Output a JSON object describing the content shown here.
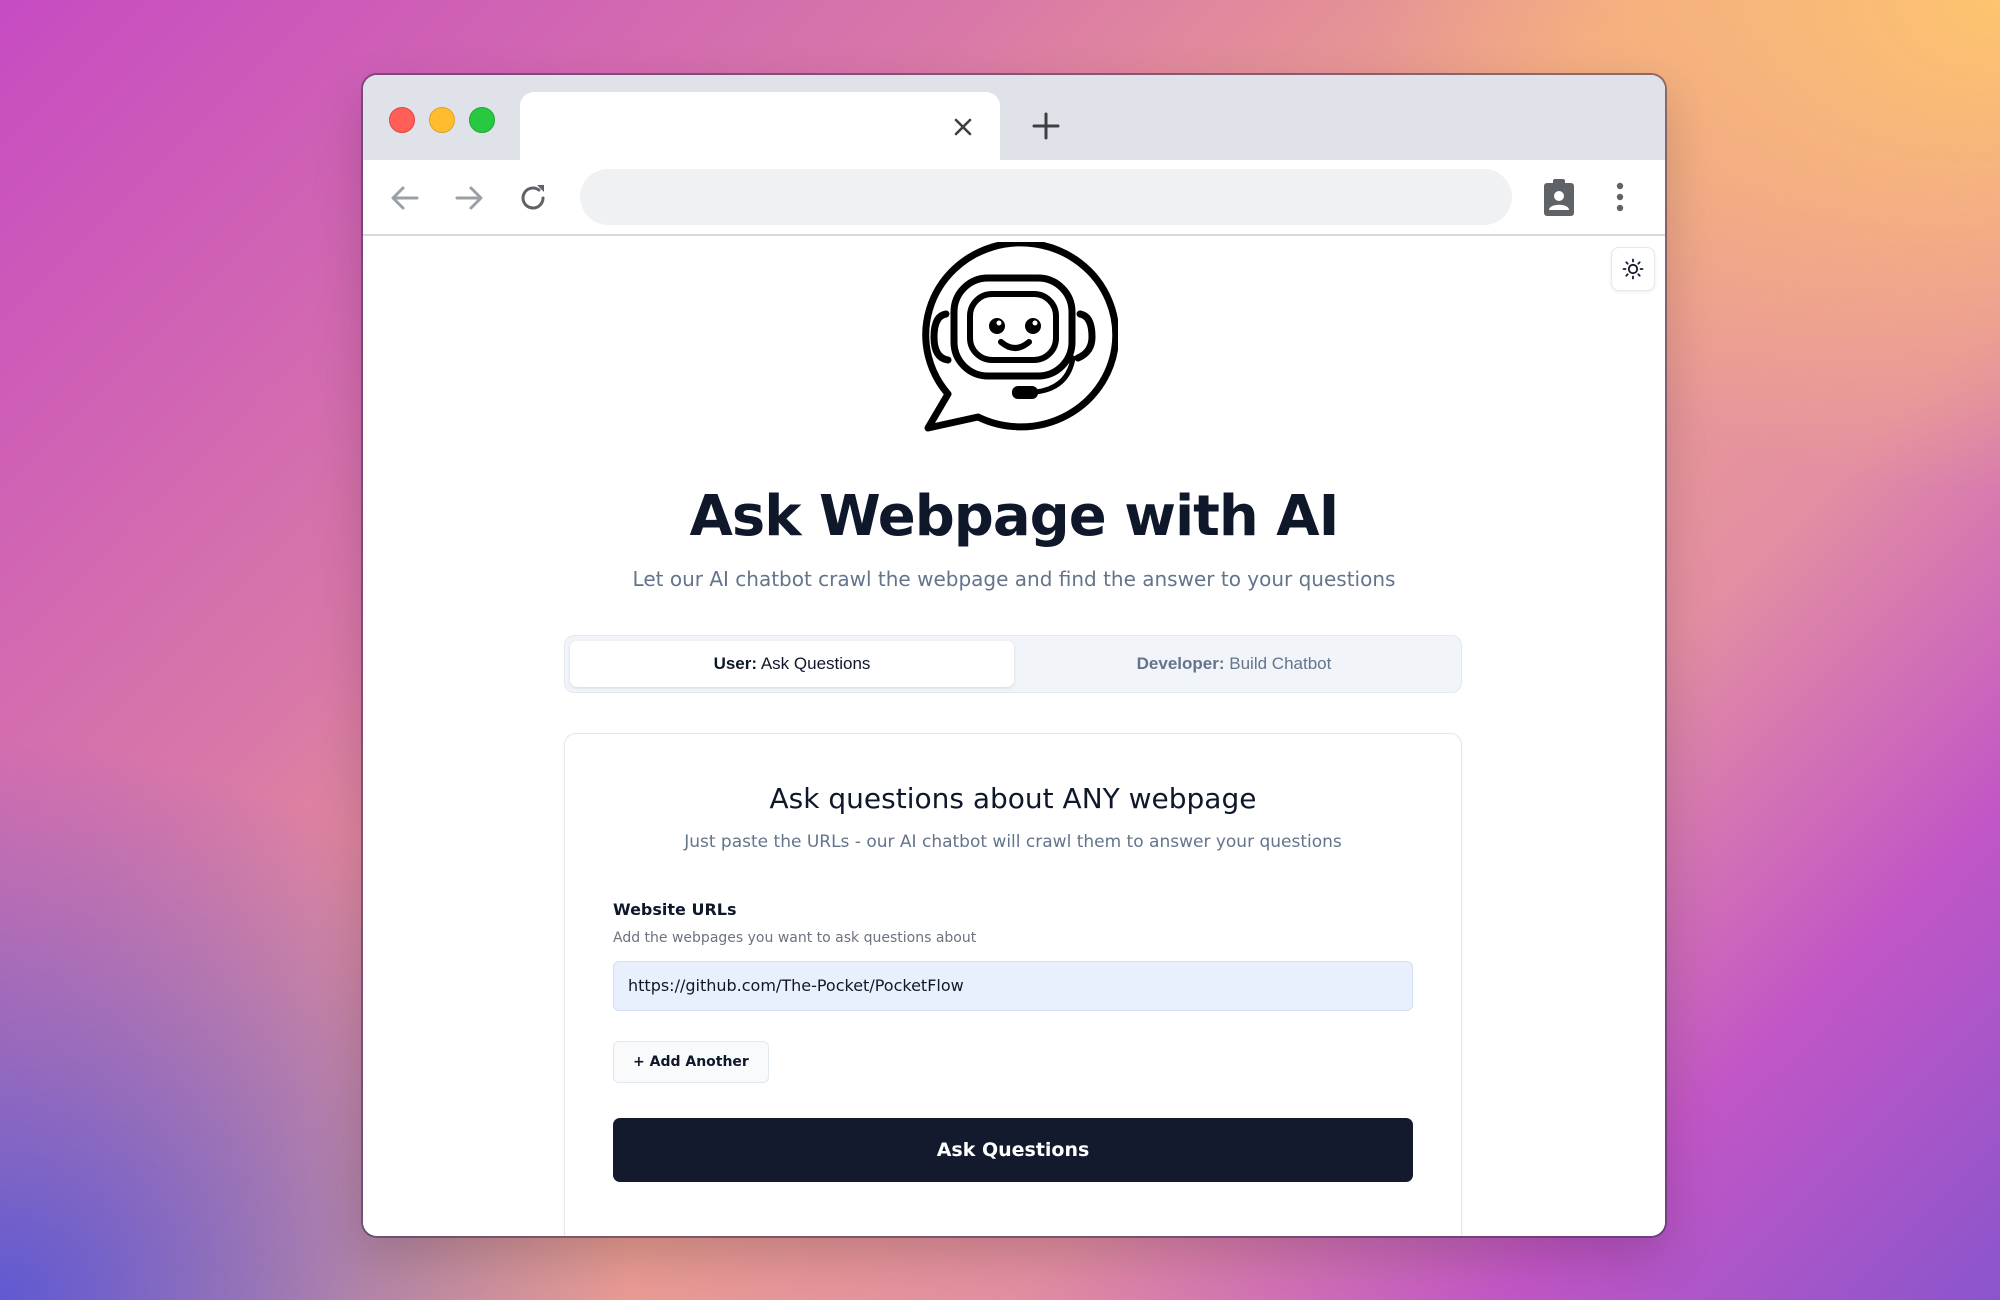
{
  "browser": {
    "tab_title": "",
    "address": "",
    "icons": {
      "close_tab": "close-icon",
      "new_tab": "plus-icon",
      "back": "arrow-left-icon",
      "forward": "arrow-right-icon",
      "reload": "reload-icon",
      "profile": "badge-icon",
      "menu": "kebab-menu-icon"
    }
  },
  "page": {
    "theme_toggle_icon": "sun-icon",
    "logo_icon": "robot-chat-bubble-icon",
    "headline": "Ask Webpage with AI",
    "subheadline": "Let our AI chatbot crawl the webpage and find the answer to your questions",
    "mode_tabs": [
      {
        "role": "User:",
        "label": "Ask Questions",
        "active": true
      },
      {
        "role": "Developer:",
        "label": "Build Chatbot",
        "active": false
      }
    ],
    "card": {
      "title": "Ask questions about ANY webpage",
      "subtitle": "Just paste the URLs - our AI chatbot will crawl them to answer your questions",
      "field_label": "Website URLs",
      "field_hint": "Add the webpages you want to ask questions about",
      "url_value": "https://github.com/The-Pocket/PocketFlow",
      "add_button": "+ Add Another",
      "submit_button": "Ask Questions"
    }
  },
  "colors": {
    "primary_button": "#131a2e",
    "heading": "#0f172a",
    "muted_text": "#64748b",
    "input_bg": "#e8effd"
  }
}
